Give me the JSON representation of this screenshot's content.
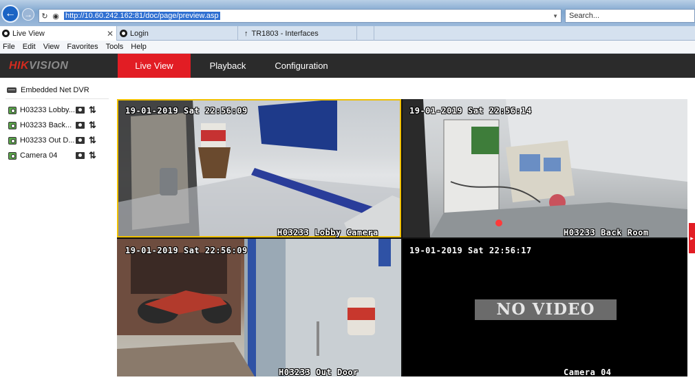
{
  "browser": {
    "url": "http://10.60.242.162:81/doc/page/preview.asp",
    "search_placeholder": "Search...",
    "tabs": [
      {
        "label": "Live View",
        "active": true
      },
      {
        "label": "Login",
        "active": false
      },
      {
        "label": "TR1803 - Interfaces",
        "active": false
      }
    ],
    "menu": [
      "File",
      "Edit",
      "View",
      "Favorites",
      "Tools",
      "Help"
    ]
  },
  "app": {
    "logo_hik": "HIK",
    "logo_vision": "VISION",
    "nav": [
      {
        "label": "Live View",
        "active": true
      },
      {
        "label": "Playback",
        "active": false
      },
      {
        "label": "Configuration",
        "active": false
      }
    ]
  },
  "sidebar": {
    "device": "Embedded Net DVR",
    "cameras": [
      {
        "label": "H03233 Lobby..."
      },
      {
        "label": "H03233 Back..."
      },
      {
        "label": "H03233 Out D..."
      },
      {
        "label": "Camera 04"
      }
    ]
  },
  "cameras": [
    {
      "timestamp": "19-01-2019 Sat 22:56:09",
      "name": "H03233 Lobby Camera"
    },
    {
      "timestamp": "19-01-2019 Sat 22:56:14",
      "name": "H03233 Back Room"
    },
    {
      "timestamp": "19-01-2019 Sat 22:56:09",
      "name": "H03233 Out Door"
    },
    {
      "timestamp": "19-01-2019 Sat 22:56:17",
      "name": "Camera 04",
      "status": "NO VIDEO"
    }
  ],
  "colors": {
    "accent": "#e21d24",
    "header_bg": "#2b2b2b",
    "selection": "#f0c000"
  }
}
